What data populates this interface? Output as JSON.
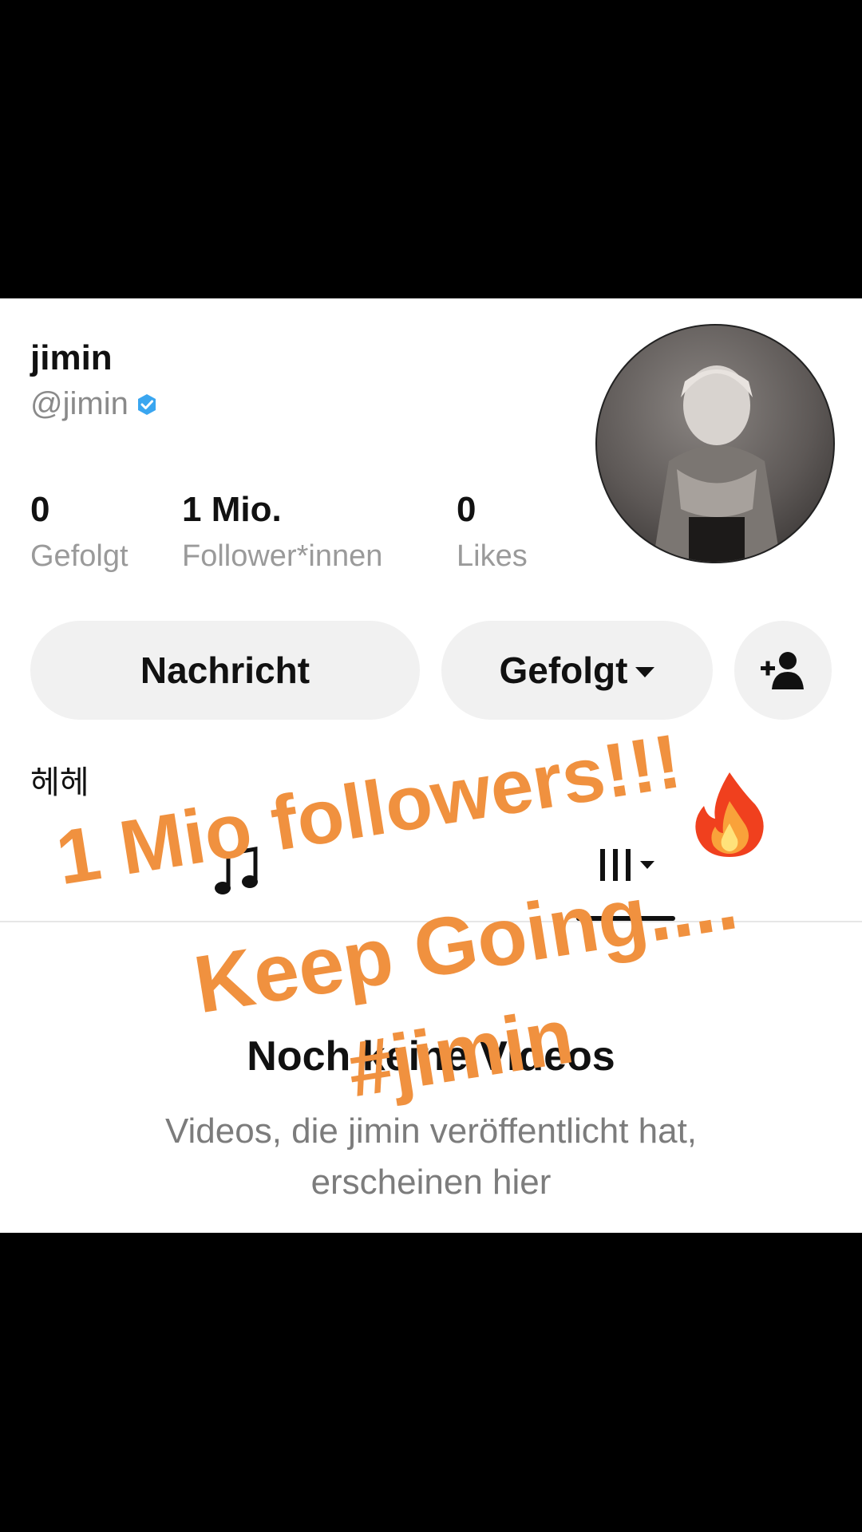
{
  "profile": {
    "display_name": "jimin",
    "username": "@jimin",
    "bio": "헤헤"
  },
  "stats": [
    {
      "value": "0",
      "label": "Gefolgt"
    },
    {
      "value": "1 Mio.",
      "label": "Follower*innen"
    },
    {
      "value": "0",
      "label": "Likes"
    }
  ],
  "buttons": {
    "message": "Nachricht",
    "following": "Gefolgt"
  },
  "empty_state": {
    "title": "Noch keine Videos",
    "description": "Videos, die jimin veröffentlicht hat, erscheinen hier"
  },
  "overlay_text": {
    "line1": "1 Mio followers!!!",
    "line2": "Keep Going....",
    "line3": "#jimin"
  },
  "icons": [
    "verified-badge-icon",
    "add-friend-icon",
    "music-note-icon",
    "reposts-bars-icon",
    "fire-emoji"
  ],
  "colors": {
    "overlay_text": "#f0913f",
    "verified": "#3aa6f0",
    "button_bg": "#f1f1f1"
  }
}
